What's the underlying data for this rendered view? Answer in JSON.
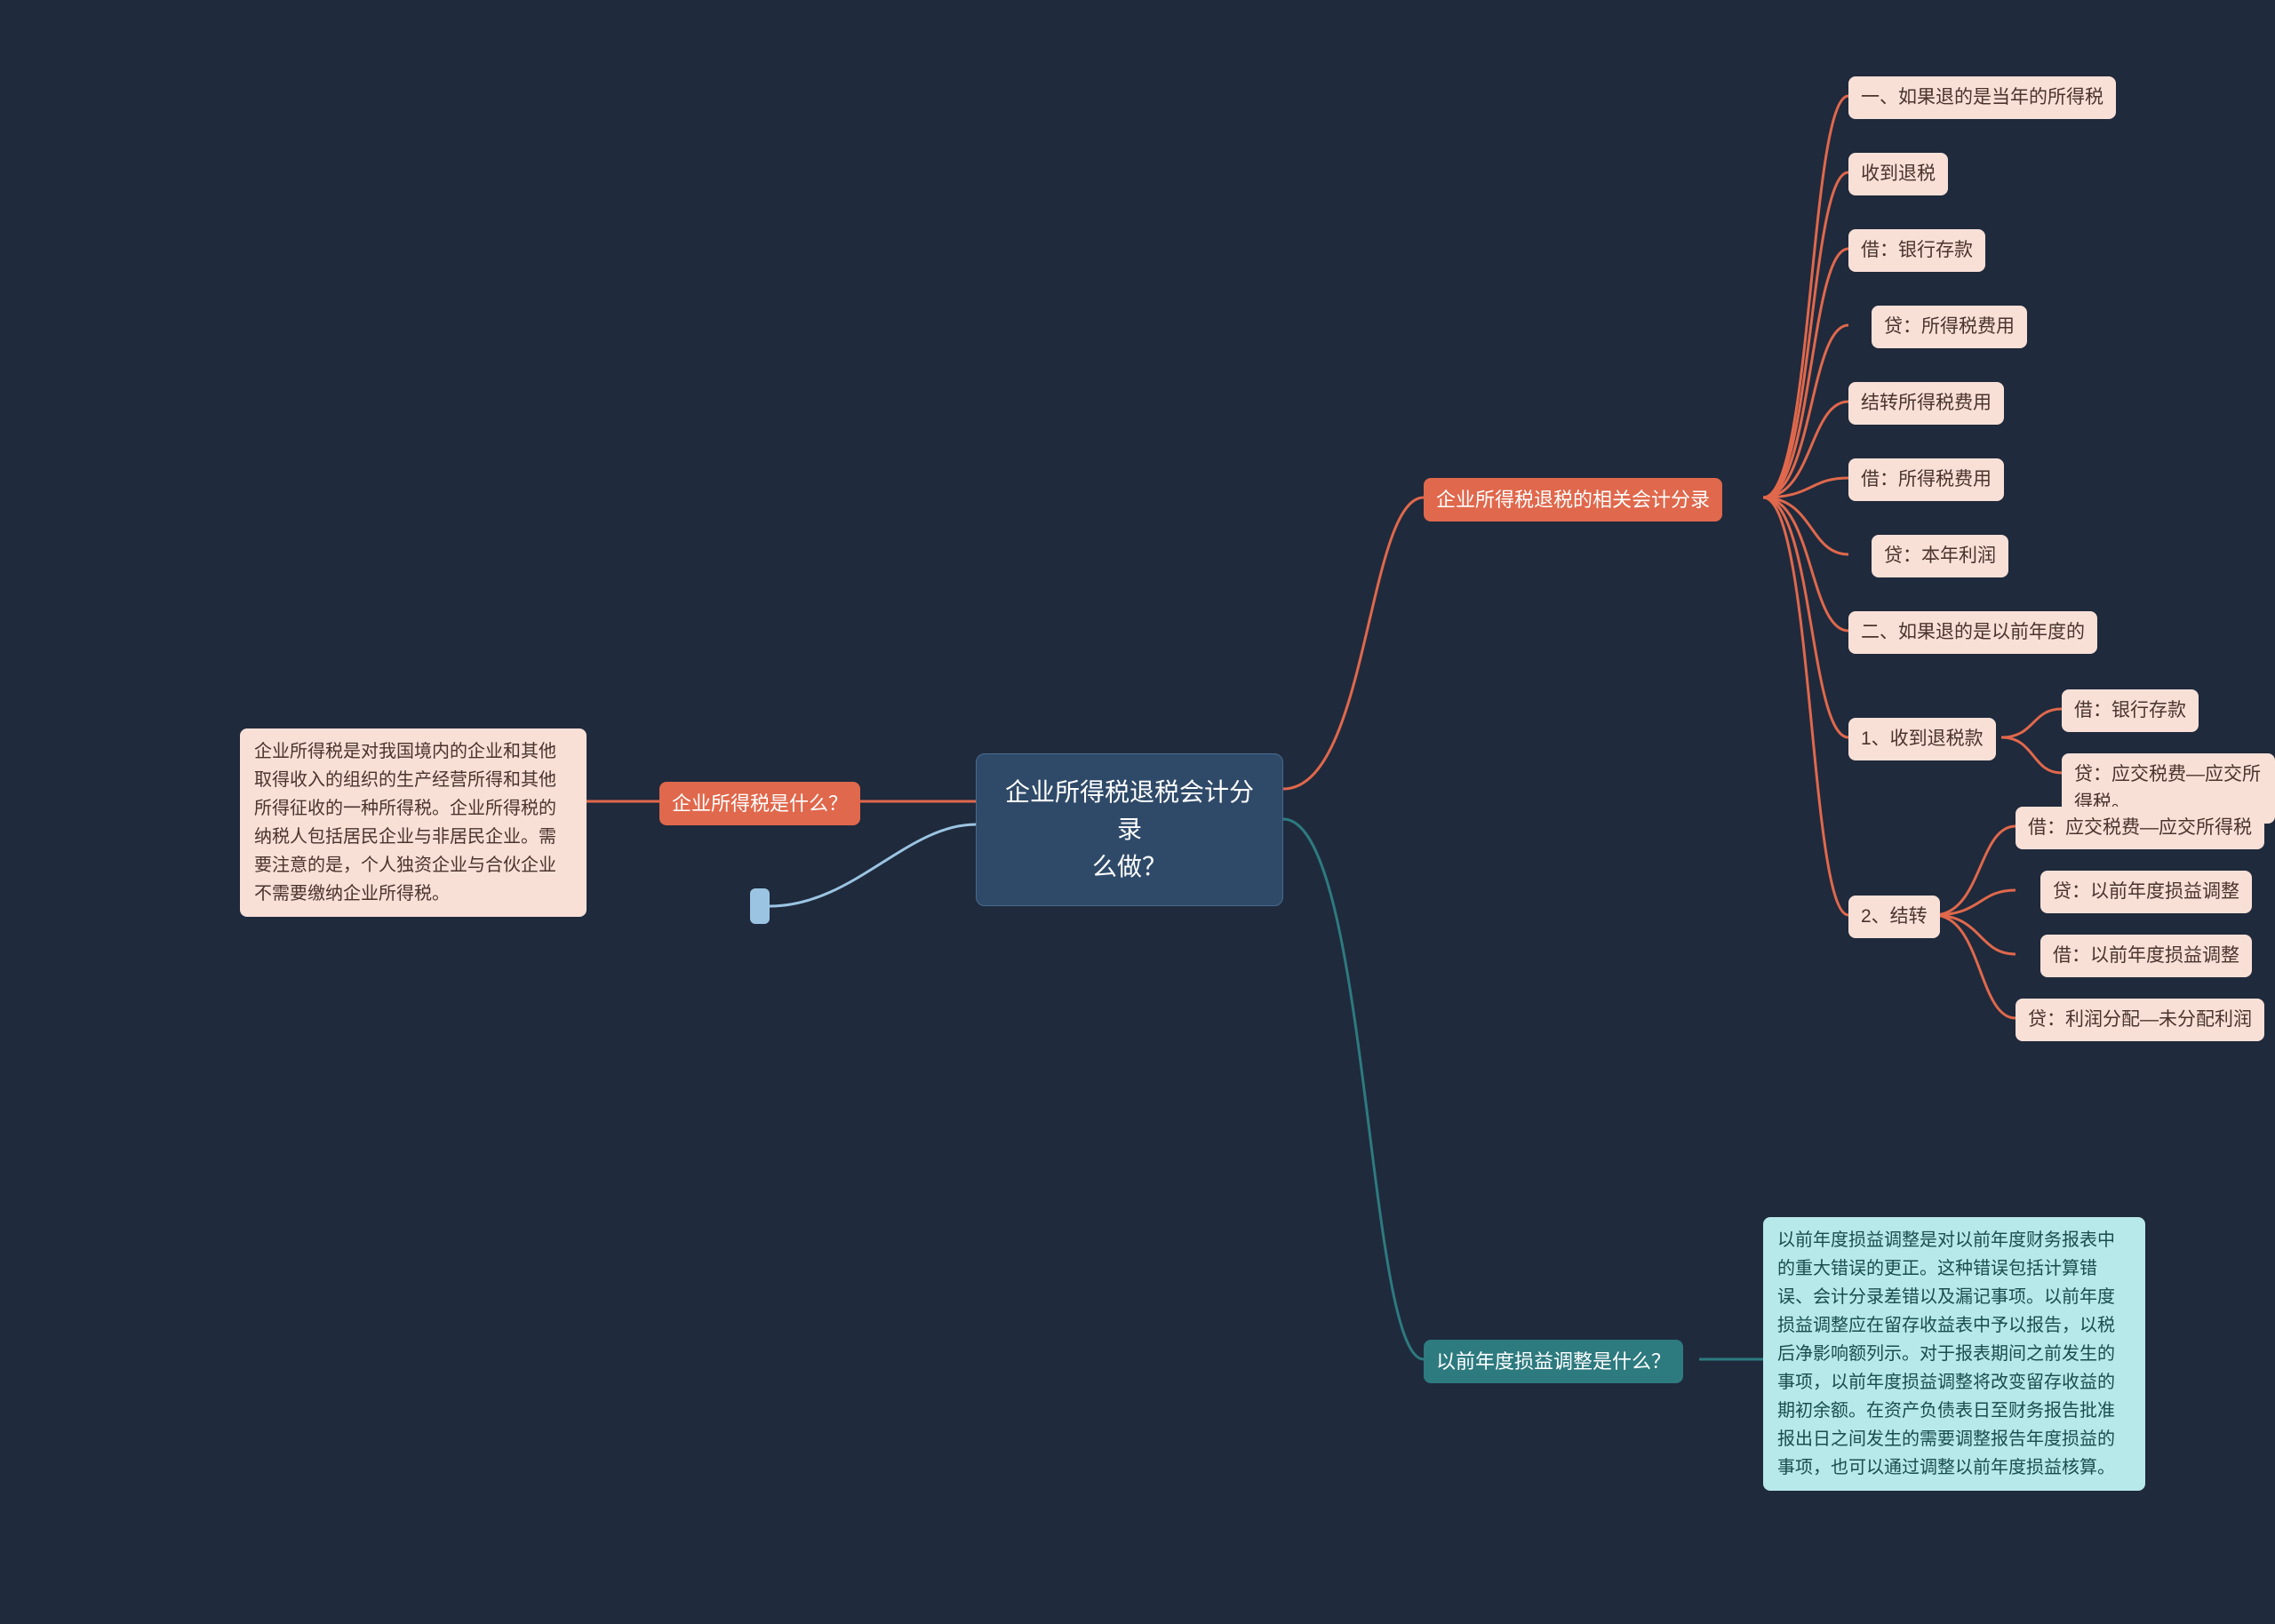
{
  "root": {
    "title": "企业所得税退税会计分录\n么做？"
  },
  "left": {
    "q_label": "企业所得税是什么？",
    "q_desc": "企业所得税是对我国境内的企业和其他取得收入的组织的生产经营所得和其他所得征收的一种所得税。企业所得税的纳税人包括居民企业与非居民企业。需要注意的是，个人独资企业与合伙企业不需要缴纳企业所得税。"
  },
  "branch1": {
    "label": "企业所得税退税的相关会计分录",
    "items": [
      "一、如果退的是当年的所得税",
      "收到退税",
      "借：银行存款",
      "贷：所得税费用",
      "结转所得税费用",
      "借：所得税费用",
      "贷：本年利润",
      "二、如果退的是以前年度的"
    ],
    "sub1": {
      "label": "1、收到退税款",
      "children": [
        "借：银行存款",
        "贷：应交税费—应交所得税。"
      ]
    },
    "sub2": {
      "label": "2、结转",
      "children": [
        "借：应交税费—应交所得税",
        "贷：以前年度损益调整",
        "借：以前年度损益调整",
        "贷：利润分配—未分配利润"
      ]
    }
  },
  "branch2": {
    "label": "以前年度损益调整是什么？",
    "desc": "以前年度损益调整是对以前年度财务报表中的重大错误的更正。这种错误包括计算错误、会计分录差错以及漏记事项。以前年度损益调整应在留存收益表中予以报告，以税后净影响额列示。对于报表期间之前发生的事项，以前年度损益调整将改变留存收益的期初余额。在资产负债表日至财务报告批准报出日之间发生的需要调整报告年度损益的事项，也可以通过调整以前年度损益核算。"
  }
}
